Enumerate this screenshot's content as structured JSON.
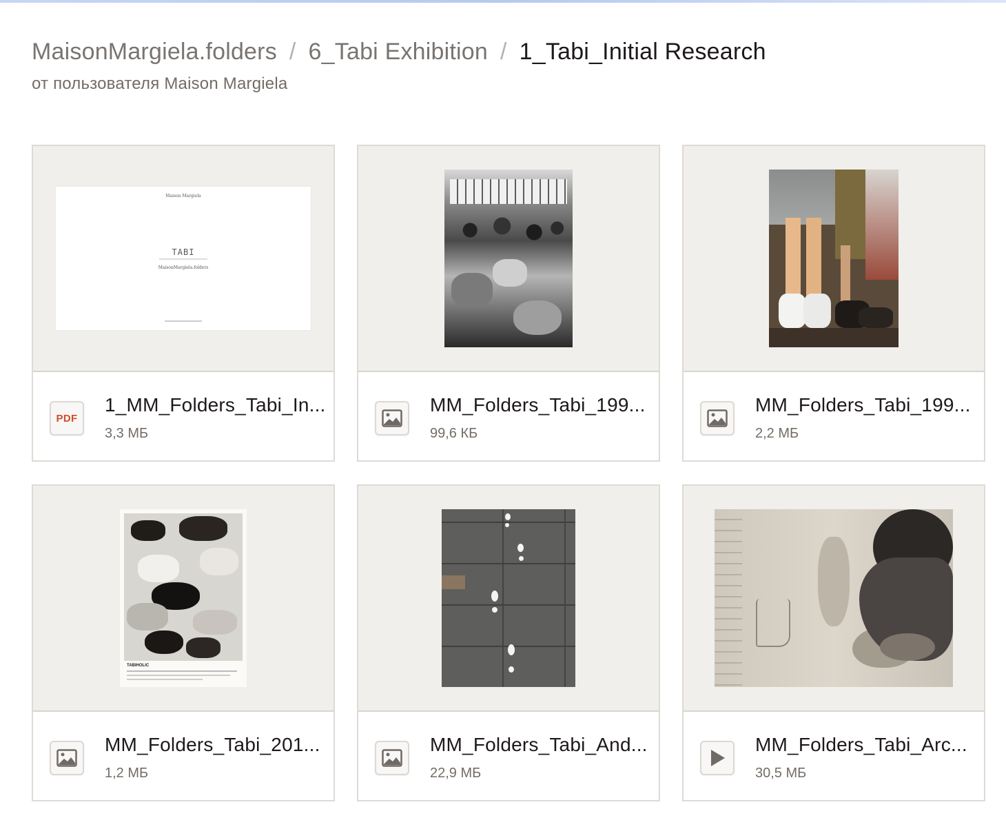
{
  "breadcrumb": {
    "items": [
      "MaisonMargiela.folders",
      "6_Tabi Exhibition"
    ],
    "current": "1_Tabi_Initial Research",
    "separator": "/"
  },
  "owner_line": "от пользователя Maison Margiela",
  "files": [
    {
      "name": "1_MM_Folders_Tabi_In...",
      "size": "3,3 МБ",
      "icon": "pdf-icon",
      "icon_label": "PDF"
    },
    {
      "name": "MM_Folders_Tabi_199...",
      "size": "99,6 КБ",
      "icon": "image-icon"
    },
    {
      "name": "MM_Folders_Tabi_199...",
      "size": "2,2 МБ",
      "icon": "image-icon"
    },
    {
      "name": "MM_Folders_Tabi_201...",
      "size": "1,2 МБ",
      "icon": "image-icon"
    },
    {
      "name": "MM_Folders_Tabi_And...",
      "size": "22,9 МБ",
      "icon": "image-icon"
    },
    {
      "name": "MM_Folders_Tabi_Arc...",
      "size": "30,5 МБ",
      "icon": "video-play-icon"
    }
  ],
  "thumb_text": {
    "doc_brand": "Maison Margiela",
    "doc_title": "TABI",
    "doc_sub": "MaisonMargiela.folders",
    "poster_title": "TABIHOLIC"
  },
  "colors": {
    "accent_pdf": "#d14b2c",
    "thumb_bg": "#f1efec",
    "border": "#dedad5"
  }
}
